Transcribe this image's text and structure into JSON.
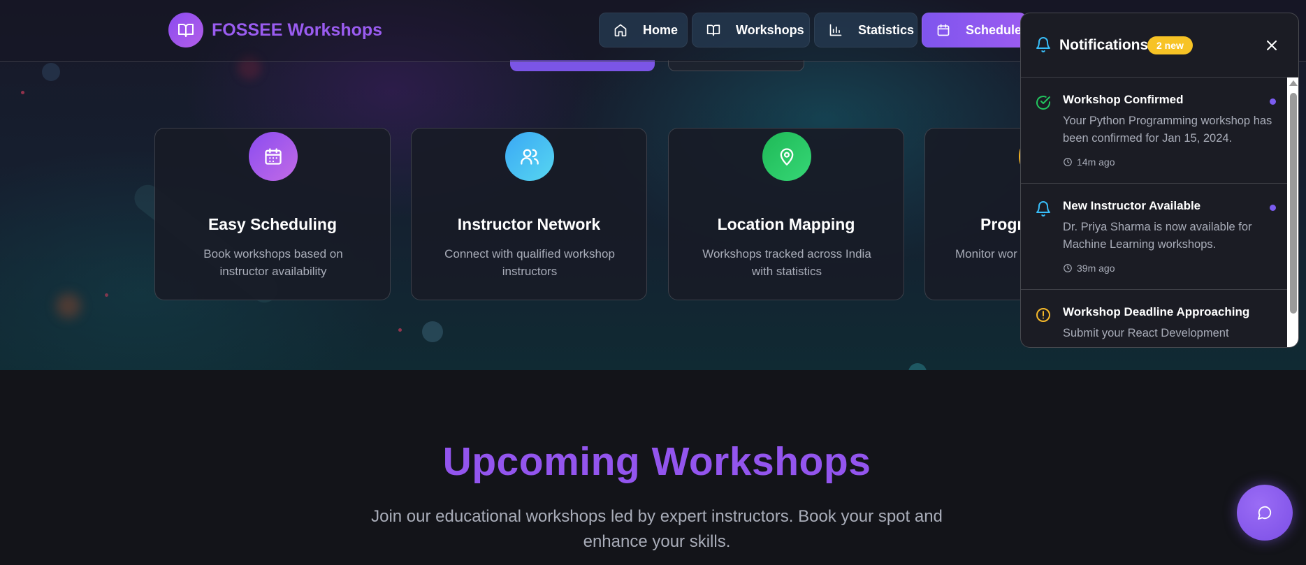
{
  "brand": {
    "name": "FOSSEE Workshops",
    "icon": "book-open-icon"
  },
  "nav": [
    {
      "label": "Home",
      "icon": "home-icon"
    },
    {
      "label": "Workshops",
      "icon": "book-open-icon"
    },
    {
      "label": "Statistics",
      "icon": "bar-chart-icon"
    },
    {
      "label": "Schedule",
      "icon": "calendar-icon",
      "active": true
    }
  ],
  "features": [
    {
      "title": "Easy Scheduling",
      "description": "Book workshops based on instructor availability",
      "icon": "calendar-icon",
      "color": "#9b5cf0"
    },
    {
      "title": "Instructor Network",
      "description": "Connect with qualified workshop instructors",
      "icon": "users-icon",
      "color": "#38bdf8"
    },
    {
      "title": "Location Mapping",
      "description": "Workshops tracked across India with statistics",
      "icon": "map-pin-icon",
      "color": "#22c55e"
    },
    {
      "title": "Progr",
      "description": "Monitor wor co",
      "icon": "chart-icon",
      "color": "#f5b82a"
    }
  ],
  "upcoming": {
    "title": "Upcoming Workshops",
    "subtitle": "Join our educational workshops led by expert instructors. Book your spot and enhance your skills."
  },
  "notifications": {
    "title": "Notifications",
    "badge": "2 new",
    "items": [
      {
        "title": "Workshop Confirmed",
        "body": "Your Python Programming workshop has been confirmed for Jan 15, 2024.",
        "time": "14m ago",
        "icon": "check-circle-icon",
        "color": "#22c55e",
        "unread": true
      },
      {
        "title": "New Instructor Available",
        "body": "Dr. Priya Sharma is now available for Machine Learning workshops.",
        "time": "39m ago",
        "icon": "bell-icon",
        "color": "#38bdf8",
        "unread": true
      },
      {
        "title": "Workshop Deadline Approaching",
        "body": "Submit your React Development",
        "time": "",
        "icon": "alert-circle-icon",
        "color": "#f5b82a",
        "unread": false
      }
    ]
  },
  "chat": {
    "icon": "chat-bubble-icon"
  }
}
